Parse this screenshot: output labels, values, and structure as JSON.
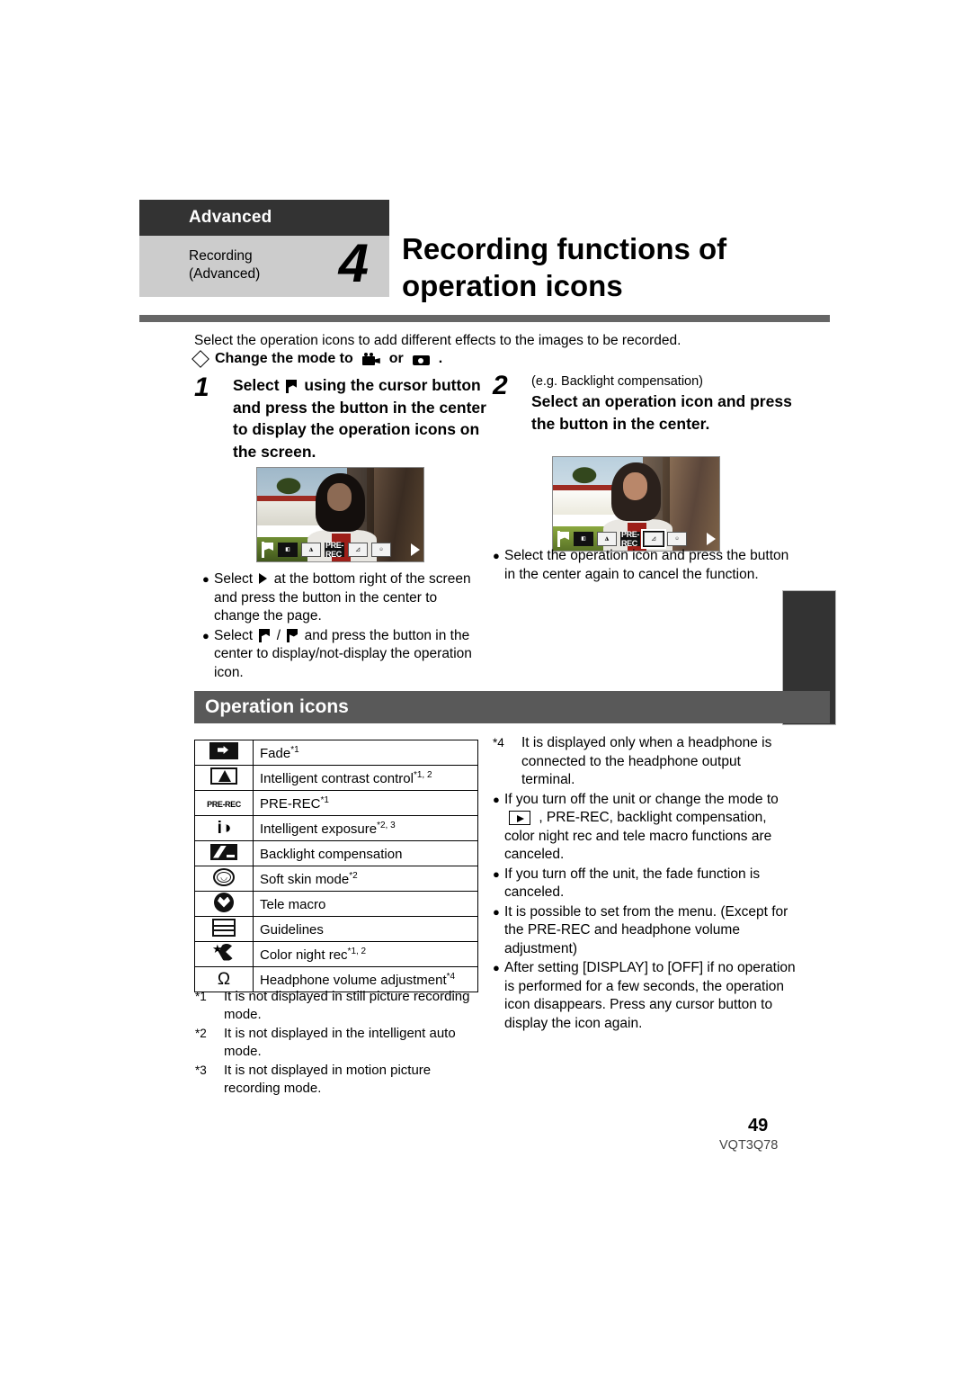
{
  "chapter": {
    "banner": "Advanced",
    "sub_line1": "Recording",
    "sub_line2": "(Advanced)",
    "number": "4",
    "title": "Recording functions of operation icons"
  },
  "intro": {
    "lead": "Select the operation icons to add different effects to the images to be recorded.",
    "mode_prefix": "Change the mode to",
    "mode_or": "or",
    "mode_period": "."
  },
  "steps": [
    {
      "number": "1",
      "text_before_icon": "Select",
      "text_after_icon": "using the cursor button and press the button in the center to display the operation icons on the screen."
    },
    {
      "number": "2",
      "eg": "(e.g. Backlight compensation)",
      "text": "Select an operation icon and press the button in the center."
    }
  ],
  "screenshot_iconbar": {
    "items": [
      "flag-icon",
      "fade-icon",
      "intelligent-contrast-icon",
      "PRE-REC",
      "backlight-compensation-icon",
      "soft-skin-icon"
    ],
    "prerec_label": "PRE-REC",
    "page_arrow": "▶"
  },
  "bullets_left": [
    {
      "parts": [
        "Select",
        "at the bottom right of the screen and press the button in the center to change the page."
      ],
      "icon": "right-triangle-icon"
    },
    {
      "parts": [
        "Select",
        "/",
        "and press the button in the center to display/not-display the operation icon."
      ],
      "icon": "flag-icons"
    }
  ],
  "bullets_right_top": [
    "Select the operation icon and press the button in the center again to cancel the function."
  ],
  "section": {
    "title": "Operation icons"
  },
  "icon_table": {
    "rows": [
      {
        "icon": "fade-icon",
        "label": "Fade",
        "sup": "*1"
      },
      {
        "icon": "intelligent-contrast-icon",
        "label": "Intelligent contrast control",
        "sup": "*1, 2"
      },
      {
        "icon": "pre-rec-icon",
        "icon_text": "PRE-REC",
        "label": "PRE-REC",
        "sup": "*1"
      },
      {
        "icon": "intelligent-exposure-icon",
        "icon_text": "i◑",
        "label": "Intelligent exposure",
        "sup": "*2, 3"
      },
      {
        "icon": "backlight-compensation-icon",
        "label": "Backlight compensation",
        "sup": ""
      },
      {
        "icon": "soft-skin-icon",
        "label": "Soft skin mode",
        "sup": "*2"
      },
      {
        "icon": "tele-macro-icon",
        "label": "Tele macro",
        "sup": ""
      },
      {
        "icon": "guidelines-icon",
        "label": "Guidelines",
        "sup": ""
      },
      {
        "icon": "color-night-rec-icon",
        "label": "Color night rec",
        "sup": "*1, 2"
      },
      {
        "icon": "headphone-icon",
        "icon_text": "Ω",
        "label": "Headphone volume adjustment",
        "sup": "*4"
      }
    ]
  },
  "footnotes_left": [
    {
      "marker": "*1",
      "text": "It is not displayed in still picture recording mode."
    },
    {
      "marker": "*2",
      "text": "It is not displayed in the intelligent auto mode."
    },
    {
      "marker": "*3",
      "text": "It is not displayed in motion picture recording mode."
    }
  ],
  "right_column": {
    "footnote4_marker": "*4",
    "footnote4_text": "It is displayed only when a headphone is connected to the headphone output terminal.",
    "bullet1_a": "If you turn off the unit or change the mode to",
    "bullet1_b": ", PRE-REC, backlight compensation, color night rec and tele macro functions are canceled.",
    "bullet2": "If you turn off the unit, the fade function is canceled.",
    "bullet3": "It is possible to set from the menu. (Except for the PRE-REC and headphone volume adjustment)",
    "bullet4": "After setting [DISPLAY] to [OFF] if no operation is performed for a few seconds, the operation icon disappears. Press any cursor button to display the icon again."
  },
  "footer": {
    "page_number": "49",
    "doc_code": "VQT3Q78"
  },
  "colors": {
    "banner_dark": "#333333",
    "chapter_grey": "#cccccc",
    "rule_grey": "#666666",
    "section_grey": "#595959"
  }
}
